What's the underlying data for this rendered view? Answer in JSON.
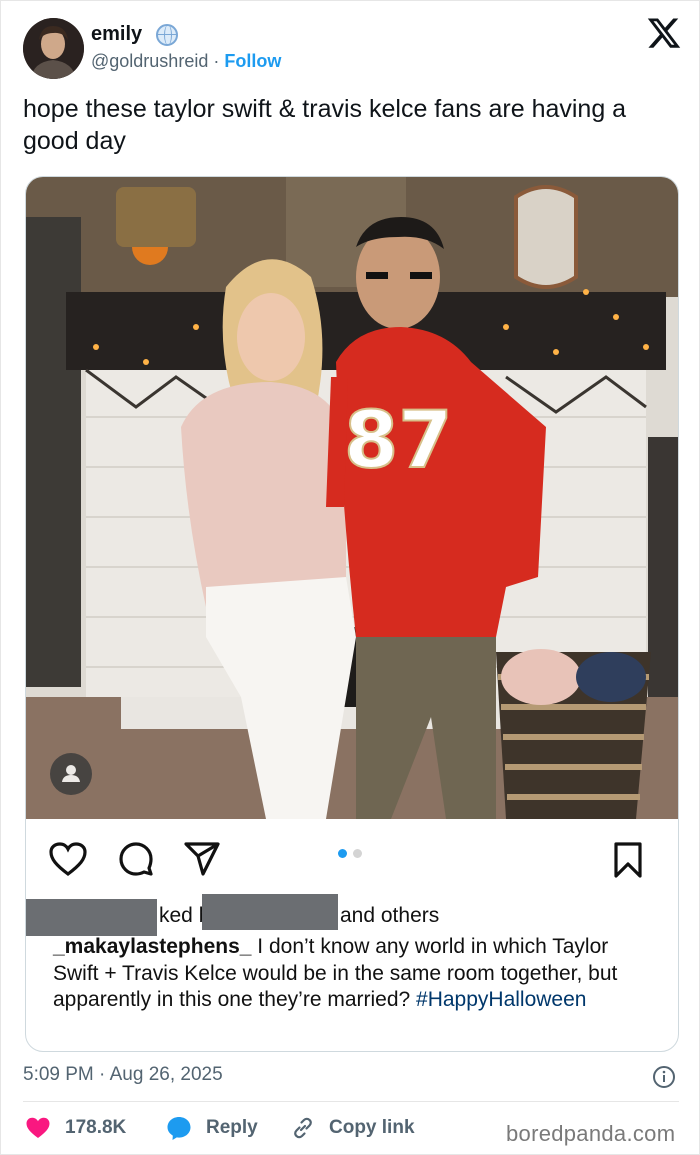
{
  "author": {
    "name": "emily",
    "handle": "@goldrushreid",
    "separator": "·",
    "follow_label": "Follow"
  },
  "tweet": {
    "text": "hope these taylor swift & travis kelce fans are having a good day"
  },
  "instagram": {
    "liked_partial_1": "ked b",
    "liked_suffix": "and others",
    "caption_user": "_makaylastephens_",
    "caption_text": " I don’t know any world in which Taylor Swift + Travis Kelce would be in the same room together, but apparently in this one they’re married? ",
    "caption_hashtag": "#HappyHalloween",
    "jersey_number": "87",
    "carousel": {
      "count": 2,
      "active": 1
    }
  },
  "meta": {
    "time": "5:09 PM",
    "separator": "·",
    "date": "Aug 26, 2025"
  },
  "actions": {
    "likes": "178.8K",
    "reply_label": "Reply",
    "copy_label": "Copy link"
  },
  "watermark": "boredpanda.com",
  "colors": {
    "like": "#f91880",
    "reply": "#1d9bf0",
    "follow": "#1d9bf0",
    "jersey": "#d62b1f"
  },
  "icons": [
    "globe-icon",
    "x-logo-icon",
    "user-tag-icon",
    "heart-icon",
    "comment-icon",
    "share-icon",
    "bookmark-icon",
    "info-icon",
    "reply-icon",
    "link-icon"
  ]
}
